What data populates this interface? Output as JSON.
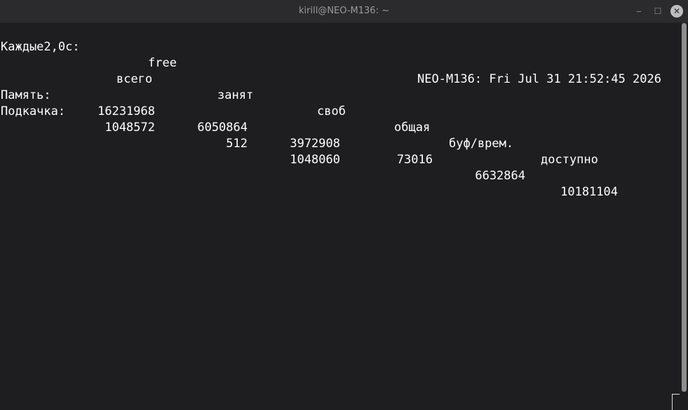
{
  "window": {
    "title": "kirill@NEO-M136: ~",
    "minimize_glyph": "‒",
    "maximize_glyph": "☐",
    "close_glyph": "✕"
  },
  "watch": {
    "interval_label": "Каждые2,0с:",
    "command": "free",
    "host_time": "NEO-M136: Fri Jul 31 21:52:45 2026"
  },
  "table": {
    "headers": [
      "всего",
      "занят",
      "своб",
      "общая",
      "буф/врем.",
      "доступно"
    ],
    "rows": [
      {
        "label": "Память:",
        "values": [
          "16231968",
          "6050864",
          "3972908",
          "73016",
          "6632864",
          "10181104"
        ]
      },
      {
        "label": "Подкачка:",
        "values": [
          "1048572",
          "512",
          "1048060",
          "",
          "",
          ""
        ]
      }
    ]
  }
}
